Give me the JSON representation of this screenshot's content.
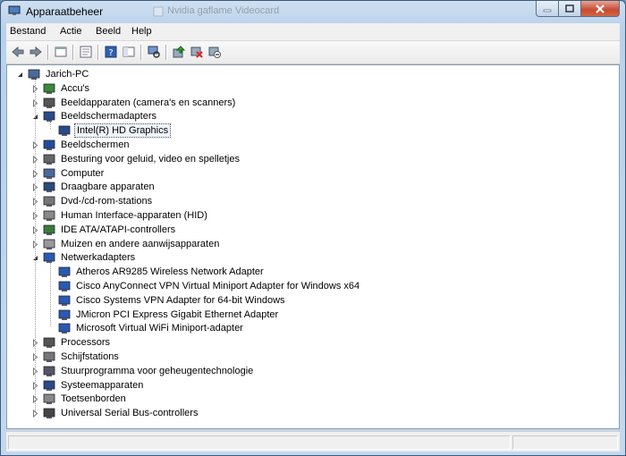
{
  "window": {
    "title": "Apparaatbeheer",
    "background_tab_text": "Nvidia gaflame Videocard"
  },
  "menu": {
    "items": [
      "Bestand",
      "Actie",
      "Beeld",
      "Help"
    ]
  },
  "toolbar": {
    "icons": [
      "back-arrow-icon",
      "forward-arrow-icon",
      "properties-icon",
      "console-icon",
      "help-icon",
      "computer-scan-icon",
      "update-driver-icon",
      "uninstall-icon",
      "disable-icon"
    ]
  },
  "tree": {
    "root": "Jarich-PC",
    "categories": [
      {
        "label": "Accu's",
        "icon": "battery-icon",
        "expanded": false
      },
      {
        "label": "Beeldapparaten (camera's en scanners)",
        "icon": "camera-icon",
        "expanded": false
      },
      {
        "label": "Beeldschermadapters",
        "icon": "display-adapter-icon",
        "expanded": true,
        "children": [
          "Intel(R) HD Graphics"
        ]
      },
      {
        "label": "Beeldschermen",
        "icon": "monitor-icon",
        "expanded": false
      },
      {
        "label": "Besturing voor geluid, video en spelletjes",
        "icon": "speaker-icon",
        "expanded": false
      },
      {
        "label": "Computer",
        "icon": "computer-icon",
        "expanded": false
      },
      {
        "label": "Draagbare apparaten",
        "icon": "portable-device-icon",
        "expanded": false
      },
      {
        "label": "Dvd-/cd-rom-stations",
        "icon": "disc-drive-icon",
        "expanded": false
      },
      {
        "label": "Human Interface-apparaten (HID)",
        "icon": "hid-icon",
        "expanded": false
      },
      {
        "label": "IDE ATA/ATAPI-controllers",
        "icon": "ide-icon",
        "expanded": false
      },
      {
        "label": "Muizen en andere aanwijsapparaten",
        "icon": "mouse-icon",
        "expanded": false
      },
      {
        "label": "Netwerkadapters",
        "icon": "network-icon",
        "expanded": true,
        "children": [
          "Atheros AR9285 Wireless Network Adapter",
          "Cisco AnyConnect VPN Virtual Miniport Adapter for Windows x64",
          "Cisco Systems VPN Adapter for 64-bit Windows",
          "JMicron PCI Express Gigabit Ethernet Adapter",
          "Microsoft Virtual WiFi Miniport-adapter"
        ]
      },
      {
        "label": "Processors",
        "icon": "processor-icon",
        "expanded": false
      },
      {
        "label": "Schijfstations",
        "icon": "disk-drive-icon",
        "expanded": false
      },
      {
        "label": "Stuurprogramma voor geheugentechnologie",
        "icon": "memory-icon",
        "expanded": false
      },
      {
        "label": "Systeemapparaten",
        "icon": "system-device-icon",
        "expanded": false
      },
      {
        "label": "Toetsenborden",
        "icon": "keyboard-icon",
        "expanded": false
      },
      {
        "label": "Universal Serial Bus-controllers",
        "icon": "usb-icon",
        "expanded": false
      }
    ],
    "selected": "Intel(R) HD Graphics"
  },
  "colors": {
    "title_gradient_top": "#cfe0f1",
    "close_button": "#c74a32",
    "selection_border": "#555555"
  }
}
